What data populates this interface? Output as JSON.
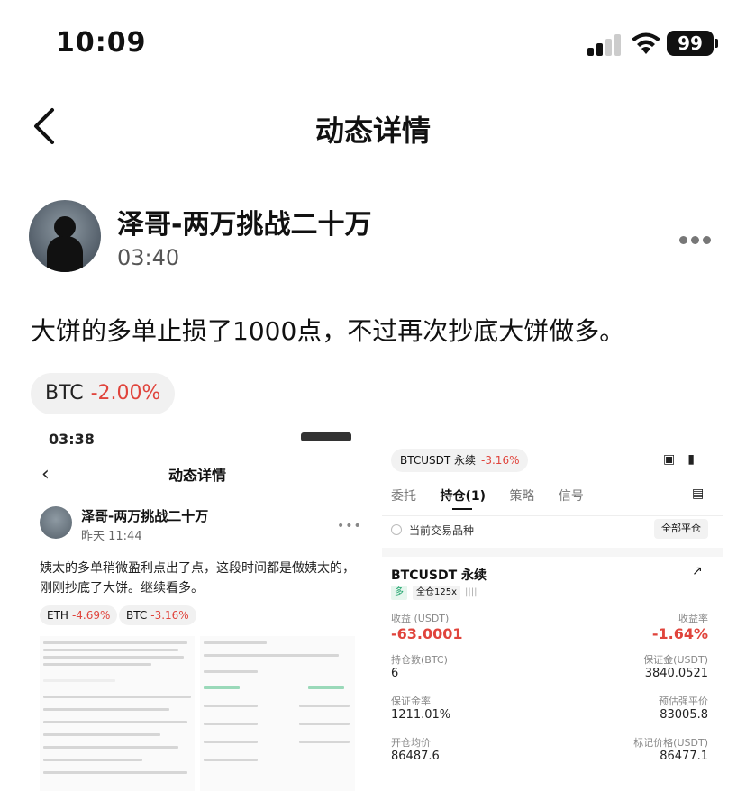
{
  "status_bar": {
    "time": "10:09",
    "battery": "99"
  },
  "nav": {
    "title": "动态详情"
  },
  "post": {
    "username": "泽哥-两万挑战二十万",
    "time": "03:40",
    "text": "大饼的多单止损了1000点，不过再次抄底大饼做多。",
    "tag": {
      "symbol": "BTC",
      "change": "-2.00%"
    }
  },
  "left_image": {
    "status_time": "03:38",
    "title": "动态详情",
    "username": "泽哥-两万挑战二十万",
    "time": "昨天 11:44",
    "text": "姨太的多单稍微盈利点出了点，这段时间都是做姨太的，刚刚抄底了大饼。继续看多。",
    "tags": [
      {
        "symbol": "ETH",
        "change": "-4.69%"
      },
      {
        "symbol": "BTC",
        "change": "-3.16%"
      }
    ]
  },
  "right_image": {
    "pair": "BTCUSDT 永续",
    "pair_change": "-3.16%",
    "tabs": [
      "委托",
      "持仓(1)",
      "策略",
      "信号"
    ],
    "current_pair_label": "当前交易品种",
    "close_all": "全部平仓",
    "position_symbol": "BTCUSDT 永续",
    "side": "多",
    "margin_mode": "全仓125x",
    "pnl_label": "收益 (USDT)",
    "pnl_value": "-63.0001",
    "roe_label": "收益率",
    "roe_value": "-1.64%",
    "size_label": "持仓数(BTC)",
    "size_value": "6",
    "margin_label": "保证金(USDT)",
    "margin_value": "3840.0521",
    "margin_ratio_label": "保证金率",
    "margin_ratio_value": "1211.01%",
    "liq_label": "预估强平价",
    "liq_value": "83005.8",
    "entry_label": "开仓均价",
    "entry_value": "86487.6",
    "mark_label": "标记价格(USDT)",
    "mark_value": "86477.1"
  }
}
